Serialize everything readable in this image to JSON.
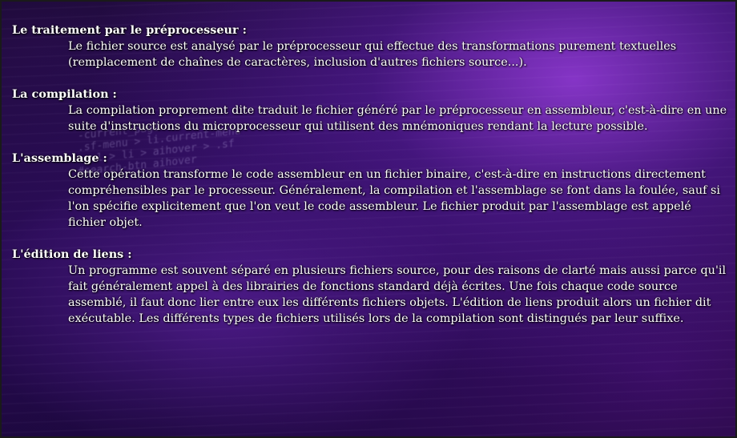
{
  "sections": [
    {
      "heading": "Le traitement par le préprocesseur  :",
      "text": "Le fichier source est analysé par le préprocesseur qui effectue des transformations purement textuelles (remplacement de chaînes de caractères, inclusion d'autres fichiers source...)."
    },
    {
      "heading": "La compilation :",
      "text": "La compilation proprement dite traduit le fichier généré par le préprocesseur en assembleur, c'est-à-dire en une suite d'instructions du microprocesseur qui utilisent des mnémoniques rendant la lecture possible."
    },
    {
      "heading": "L'assemblage :",
      "text": "Cette opération transforme le code assembleur en un fichier binaire, c'est-à-dire en instructions directement compréhensibles par le processeur. Généralement, la compilation et l'assemblage se font dans la foulée, sauf si l'on spécifie explicitement que l'on veut le code assembleur. Le fichier produit par l'assemblage est appelé fichier objet."
    },
    {
      "heading": "L'édition de liens :",
      "text": "Un programme est souvent séparé en plusieurs fichiers source, pour des raisons de clarté mais aussi parce qu'il fait généralement appel à des librairies de fonctions standard déjà écrites. Une fois chaque code source assemblé, il faut donc lier entre eux les différents fichiers objets. L'édition de liens produit alors un fichier dit exécutable. Les différents types de fichiers utilisés lors de la compilation sont distingués par leur suffixe."
    }
  ],
  "background_code": [
    "-current_page",
    ".sf-menu > li.current-menu",
    "> ul > li > aihover > .sf",
    "#search-btn aihover"
  ],
  "colors": {
    "text": "#ffffff",
    "background_primary": "#2a0d52",
    "background_accent": "#9a3cdc"
  }
}
